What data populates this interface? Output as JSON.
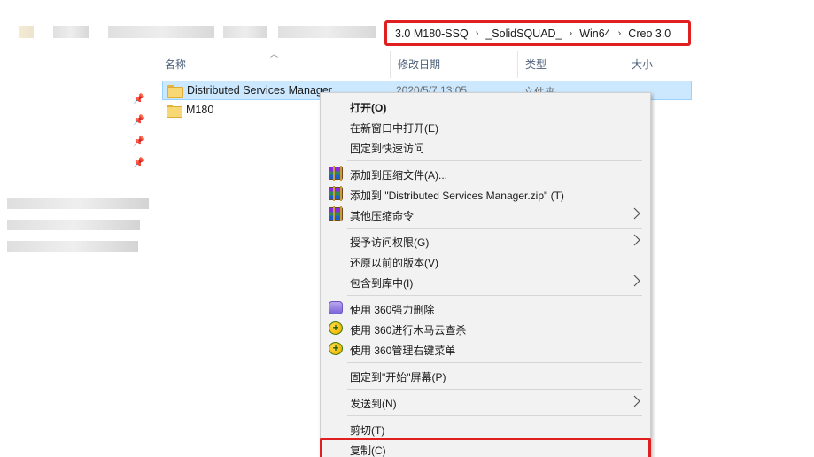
{
  "address_bar": {
    "breadcrumbs": [
      "3.0 M180-SSQ",
      "_SolidSQUAD_",
      "Win64",
      "Creo 3.0"
    ],
    "separator": "›"
  },
  "columns": {
    "name": "名称",
    "date": "修改日期",
    "type": "类型",
    "size": "大小"
  },
  "files": [
    {
      "name": "Distributed Services Manager",
      "date": "2020/5/7 13:05",
      "type": "文件夹",
      "selected": true
    },
    {
      "name": "M180",
      "date": "",
      "type": "",
      "selected": false
    }
  ],
  "context_menu": {
    "items": [
      {
        "label": "打开(O)",
        "bold": true
      },
      {
        "label": "在新窗口中打开(E)"
      },
      {
        "label": "固定到快速访问"
      },
      {
        "label": "添加到压缩文件(A)...",
        "icon": "winrar-icon"
      },
      {
        "label": "添加到 \"Distributed Services Manager.zip\" (T)",
        "icon": "winrar-icon"
      },
      {
        "label": "其他压缩命令",
        "icon": "winrar-icon",
        "submenu": true
      },
      {
        "label": "授予访问权限(G)",
        "submenu": true
      },
      {
        "label": "还原以前的版本(V)"
      },
      {
        "label": "包含到库中(I)",
        "submenu": true
      },
      {
        "label": "使用 360强力删除",
        "icon": "shredder-icon"
      },
      {
        "label": "使用 360进行木马云查杀",
        "icon": "360-icon"
      },
      {
        "label": "使用 360管理右键菜单",
        "icon": "360-icon"
      },
      {
        "label": "固定到\"开始\"屏幕(P)"
      },
      {
        "label": "发送到(N)",
        "submenu": true
      },
      {
        "label": "剪切(T)"
      },
      {
        "label": "复制(C)"
      }
    ]
  },
  "colors": {
    "highlight_red": "#e02020",
    "selection_bg": "#cce8ff",
    "selection_border": "#99d1ff",
    "header_text": "#4c607a"
  }
}
